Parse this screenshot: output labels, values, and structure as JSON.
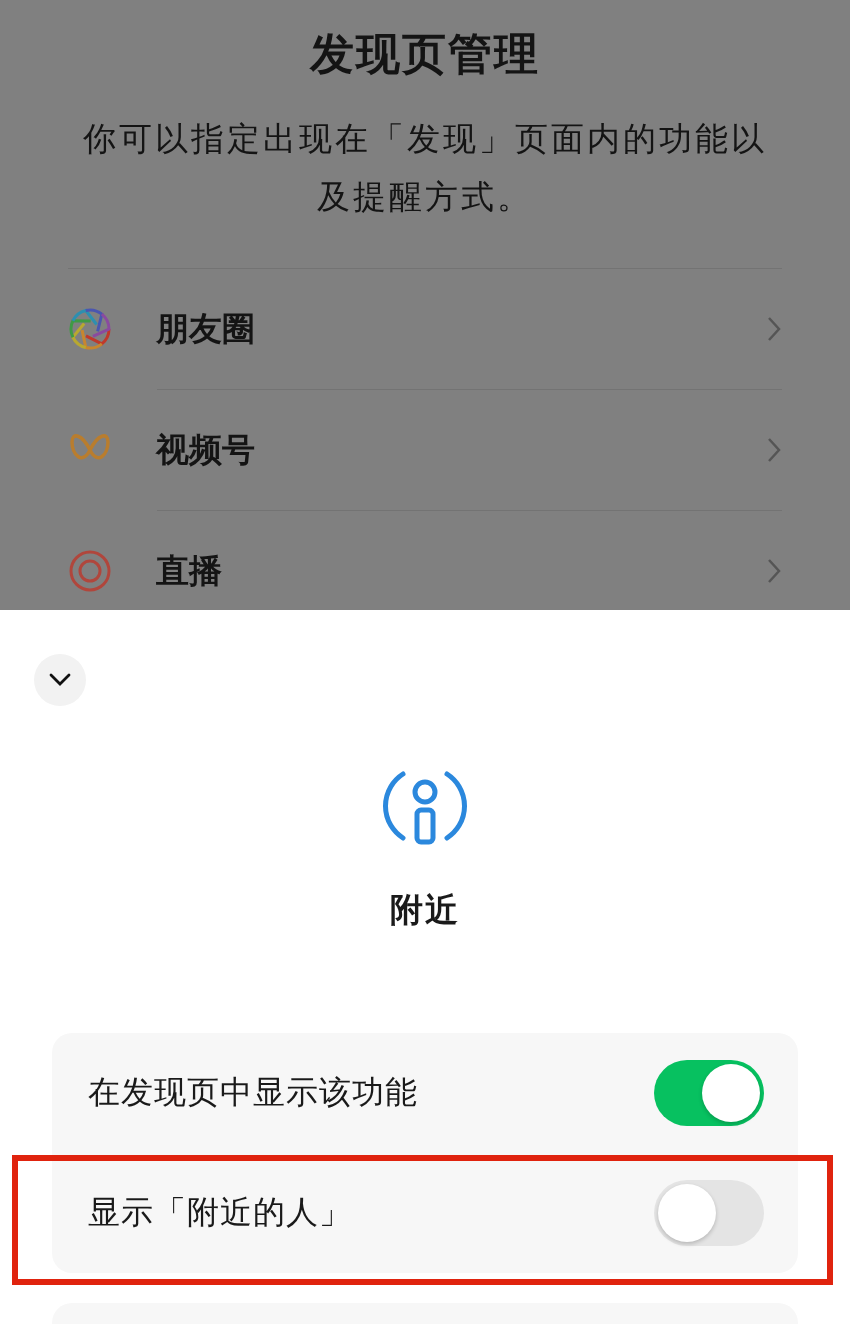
{
  "page": {
    "title": "发现页管理",
    "description": "你可以指定出现在「发现」页面内的功能以及提醒方式。",
    "items": [
      {
        "label": "朋友圈",
        "kind": "moments"
      },
      {
        "label": "视频号",
        "kind": "channels"
      },
      {
        "label": "直播",
        "kind": "live"
      }
    ]
  },
  "sheet": {
    "title": "附近",
    "settings": [
      {
        "label": "在发现页中显示该功能",
        "on": true,
        "highlighted": false
      },
      {
        "label": "显示「附近的人」",
        "on": false,
        "highlighted": true
      }
    ]
  }
}
